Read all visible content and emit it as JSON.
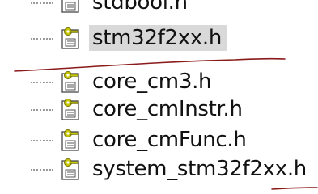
{
  "files": [
    {
      "name": "stdbool.h",
      "selected": false
    },
    {
      "name": "stm32f2xx.h",
      "selected": true
    },
    {
      "name": "core_cm3.h",
      "selected": false
    },
    {
      "name": "core_cmInstr.h",
      "selected": false
    },
    {
      "name": "core_cmFunc.h",
      "selected": false
    },
    {
      "name": "system_stm32f2xx.h",
      "selected": false
    }
  ],
  "icons": {
    "file": "header-file-icon",
    "marker": "key-badge-icon"
  },
  "colors": {
    "selection_background": "#d9d9d9",
    "annotation_stroke": "#8b1a1a",
    "icon_badge": "#c8c800"
  }
}
